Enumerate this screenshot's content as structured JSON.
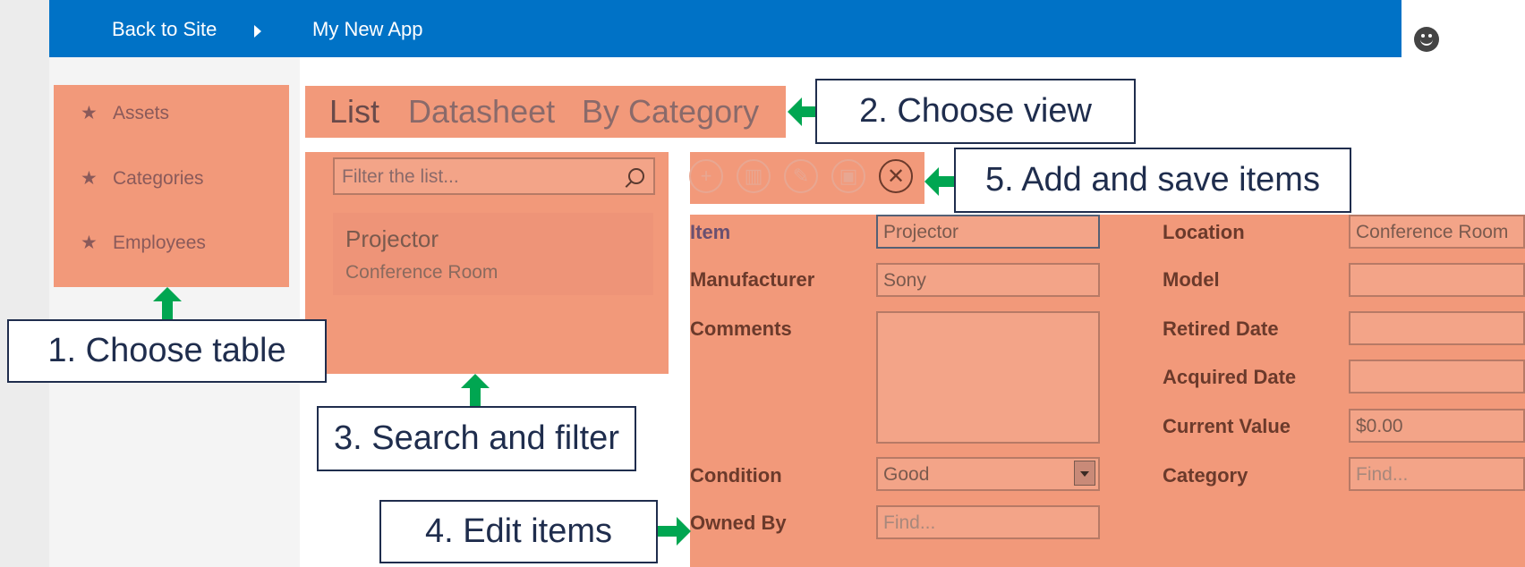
{
  "topbar": {
    "back_label": "Back to Site",
    "app_title": "My New App"
  },
  "nav": {
    "items": [
      {
        "label": "Assets"
      },
      {
        "label": "Categories"
      },
      {
        "label": "Employees"
      }
    ],
    "star": "★"
  },
  "views": {
    "tabs": [
      {
        "label": "List"
      },
      {
        "label": "Datasheet"
      },
      {
        "label": "By Category"
      }
    ]
  },
  "list": {
    "filter_placeholder": "Filter the list...",
    "items": [
      {
        "title": "Projector",
        "subtitle": "Conference Room"
      }
    ]
  },
  "toolbar": {
    "icons": [
      "add-icon",
      "delete-icon",
      "edit-icon",
      "save-icon",
      "close-icon"
    ]
  },
  "form": {
    "item_label": "Item",
    "item_value": "Projector",
    "manufacturer_label": "Manufacturer",
    "manufacturer_value": "Sony",
    "comments_label": "Comments",
    "condition_label": "Condition",
    "condition_value": "Good",
    "owned_by_label": "Owned By",
    "owned_by_placeholder": "Find...",
    "location_label": "Location",
    "location_value": "Conference Room",
    "model_label": "Model",
    "retired_label": "Retired Date",
    "acquired_label": "Acquired Date",
    "value_label": "Current Value",
    "value_value": "$0.00",
    "category_label": "Category",
    "category_placeholder": "Find..."
  },
  "callouts": {
    "c1": "1. Choose table",
    "c2": "2. Choose view",
    "c3": "3. Search and filter",
    "c4": "4. Edit items",
    "c5": "5. Add and save items"
  },
  "colors": {
    "topbar": "#0072c6",
    "highlight": "#f2997a",
    "arrow": "#00a651",
    "callout_border": "#1f2d4d"
  }
}
